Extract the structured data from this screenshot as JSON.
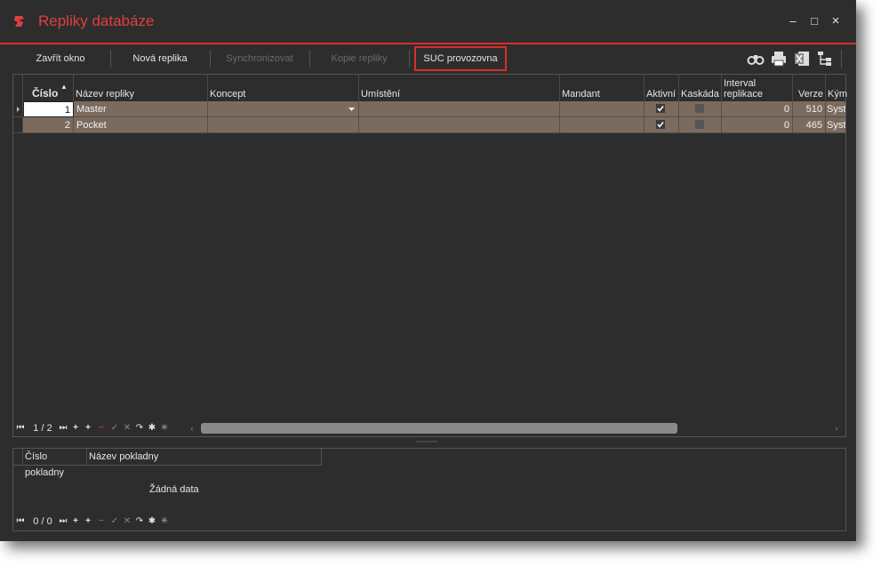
{
  "window": {
    "title": "Repliky databáze",
    "accent_color": "#d42f2f",
    "controls": {
      "minimize": "–",
      "maximize": "□",
      "close": "×"
    }
  },
  "toolbar": {
    "buttons": [
      {
        "label": "Zavřít okno",
        "enabled": true
      },
      {
        "label": "Nová replika",
        "enabled": true
      },
      {
        "label": "Synchronizovat",
        "enabled": false
      },
      {
        "label": "Kopie repliky",
        "enabled": false
      },
      {
        "label": "SUC provozovna",
        "enabled": true,
        "highlighted": true
      }
    ],
    "icons": [
      "binoculars-icon",
      "printer-icon",
      "excel-icon",
      "tree-settings-icon"
    ]
  },
  "main_grid": {
    "columns": [
      {
        "label": "Číslo",
        "sorted": "asc"
      },
      {
        "label": "Název repliky"
      },
      {
        "label": "Koncept"
      },
      {
        "label": "Umístění"
      },
      {
        "label": "Mandant"
      },
      {
        "label": "Aktivní"
      },
      {
        "label": "Kaskáda"
      },
      {
        "label": "Interval replikace"
      },
      {
        "label": "Verze"
      },
      {
        "label": "Kým"
      }
    ],
    "rows": [
      {
        "cislo": "1",
        "nazev": "Master",
        "koncept": "",
        "umisteni": "",
        "mandant": "",
        "aktivni": true,
        "kaskada": false,
        "interval": "0",
        "verze": "510",
        "kym": "Syst"
      },
      {
        "cislo": "2",
        "nazev": "Pocket",
        "koncept": "",
        "umisteni": "",
        "mandant": "",
        "aktivni": true,
        "kaskada": false,
        "interval": "0",
        "verze": "465",
        "kym": "Syst"
      }
    ],
    "navigator": {
      "position": "1 / 2"
    }
  },
  "detail_grid": {
    "columns": [
      {
        "label": "Číslo pokladny"
      },
      {
        "label": "Název pokladny"
      }
    ],
    "empty_text": "Žádná data",
    "navigator": {
      "position": "0 / 0"
    }
  }
}
